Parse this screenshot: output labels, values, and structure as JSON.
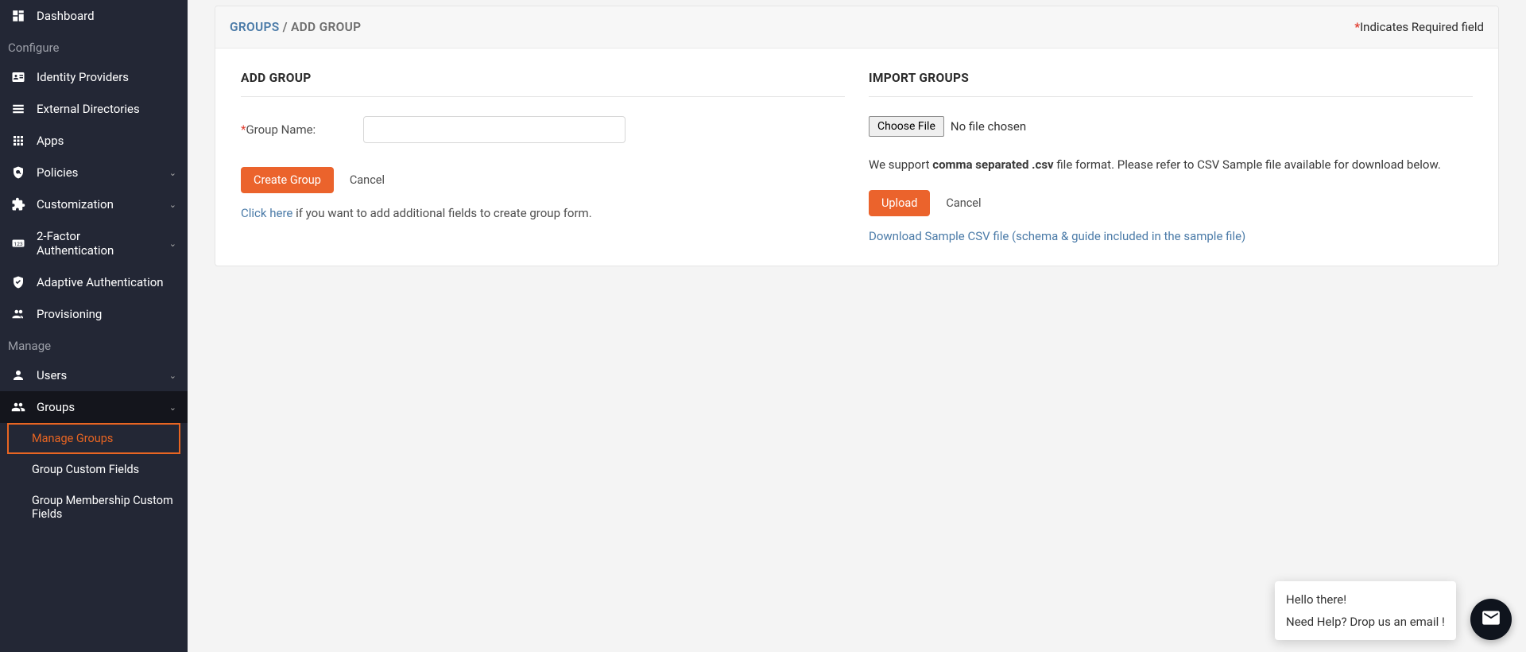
{
  "sidebar": {
    "dashboard": "Dashboard",
    "section_configure": "Configure",
    "identity_providers": "Identity Providers",
    "external_directories": "External Directories",
    "apps": "Apps",
    "policies": "Policies",
    "customization": "Customization",
    "two_factor": "2-Factor Authentication",
    "adaptive_auth": "Adaptive Authentication",
    "provisioning": "Provisioning",
    "section_manage": "Manage",
    "users": "Users",
    "groups": "Groups",
    "sub_manage_groups": "Manage Groups",
    "sub_group_custom_fields": "Group Custom Fields",
    "sub_group_membership_custom": "Group Membership Custom Fields"
  },
  "breadcrumb": {
    "groups": "GROUPS",
    "sep": "/",
    "current": "ADD GROUP"
  },
  "required_note": "Indicates Required field",
  "add_group": {
    "heading": "ADD GROUP",
    "label": "Group Name:",
    "create_btn": "Create Group",
    "cancel_btn": "Cancel",
    "hint_link": "Click here",
    "hint_rest": " if you want to add additional fields to create group form."
  },
  "import_groups": {
    "heading": "IMPORT GROUPS",
    "choose_file": "Choose File",
    "no_file": "No file chosen",
    "support_pre": "We support ",
    "support_bold": "comma separated .csv",
    "support_post": " file format. Please refer to CSV Sample file available for download below.",
    "upload_btn": "Upload",
    "cancel_btn": "Cancel",
    "download_link": "Download Sample CSV file (schema & guide included in the sample file)"
  },
  "chat": {
    "line1": "Hello there!",
    "line2": "Need Help? Drop us an email !"
  }
}
